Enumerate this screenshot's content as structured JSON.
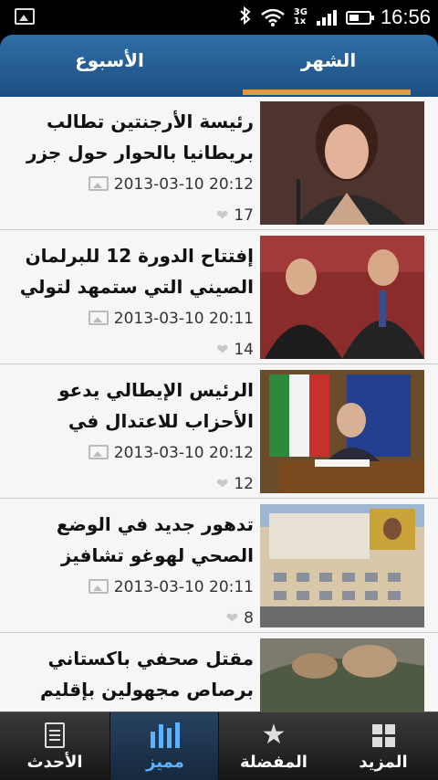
{
  "status_bar": {
    "time": "16:56",
    "network": "3G",
    "network_sub": "1x",
    "icons": [
      "image-notification-icon",
      "bluetooth-icon",
      "wifi-icon",
      "signal-icon",
      "battery-icon"
    ]
  },
  "tabs": [
    {
      "label": "الشهر",
      "selected": true
    },
    {
      "label": "الأسبوع",
      "selected": false
    }
  ],
  "colors": {
    "tab_bar": "#1d4f82",
    "tab_indicator": "#e59a3a",
    "active_nav": "#5bb3ff"
  },
  "articles": [
    {
      "title": "رئيسة الأرجنتين تطالب بريطانيا بالحوار حول جزر",
      "date": "2013-03-10 20:12",
      "likes": "17",
      "image": "woman-speaking-at-microphone"
    },
    {
      "title": "إفتتاح الدورة 12 للبرلمان الصيني التي ستمهد لتولي",
      "date": "2013-03-10 20:11",
      "likes": "14",
      "image": "two-men-clapping"
    },
    {
      "title": "الرئيس الإيطالي يدعو الأحزاب للاعتدال في",
      "date": "2013-03-10 20:12",
      "likes": "12",
      "image": "man-at-desk-with-flags"
    },
    {
      "title": "تدهور جديد في الوضع الصحي لهوغو تشافيز",
      "date": "2013-03-10 20:11",
      "likes": "8",
      "image": "military-hospital-building"
    },
    {
      "title": "مقتل صحفي باكستاني برصاص مجهولين بإقليم",
      "date": "",
      "likes": "",
      "image": "soldiers-boots"
    }
  ],
  "bottom_nav": [
    {
      "label": "المزيد",
      "icon": "grid-icon"
    },
    {
      "label": "المفضلة",
      "icon": "star-icon"
    },
    {
      "label": "مميز",
      "icon": "bars-icon",
      "selected": true
    },
    {
      "label": "الأحدث",
      "icon": "document-icon"
    }
  ]
}
